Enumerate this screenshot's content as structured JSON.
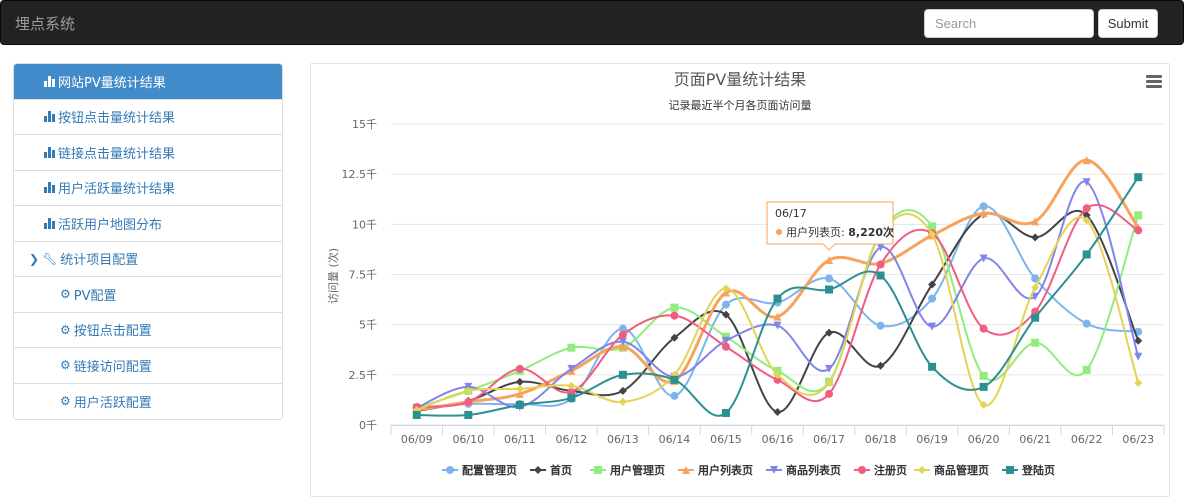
{
  "navbar": {
    "brand": "埋点系统",
    "search_placeholder": "Search",
    "submit_label": "Submit"
  },
  "sidebar": {
    "items": [
      {
        "label": "网站PV量统计结果",
        "icon": "bar-chart-icon",
        "active": true
      },
      {
        "label": "按钮点击量统计结果",
        "icon": "bar-chart-icon"
      },
      {
        "label": "链接点击量统计结果",
        "icon": "bar-chart-icon"
      },
      {
        "label": "用户活跃量统计结果",
        "icon": "bar-chart-icon"
      },
      {
        "label": "活跃用户地图分布",
        "icon": "bar-chart-icon"
      },
      {
        "label": "统计项目配置",
        "icon": "wrench-icon",
        "expanded": true
      },
      {
        "label": "PV配置",
        "icon": "gear-icon"
      },
      {
        "label": "按钮点击配置",
        "icon": "gear-icon"
      },
      {
        "label": "链接访问配置",
        "icon": "gear-icon"
      },
      {
        "label": "用户活跃配置",
        "icon": "gear-icon"
      }
    ]
  },
  "tooltip": {
    "date": "06/17",
    "series": "用户列表页",
    "value": "8,220次",
    "color": "#f7a35c"
  },
  "chart_data": {
    "type": "line",
    "title": "页面PV量统计结果",
    "subtitle": "记录最近半个月各页面访问量",
    "xlabel": "",
    "ylabel": "访问量 (次)",
    "ylim": [
      0,
      15000
    ],
    "yticks": [
      0,
      2500,
      5000,
      7500,
      10000,
      12500,
      15000
    ],
    "ytick_labels": [
      "0千",
      "2.5千",
      "5千",
      "7.5千",
      "10千",
      "12.5千",
      "15千"
    ],
    "grid": true,
    "legend": "bottom",
    "categories": [
      "06/09",
      "06/10",
      "06/11",
      "06/12",
      "06/13",
      "06/14",
      "06/15",
      "06/16",
      "06/17",
      "06/18",
      "06/19",
      "06/20",
      "06/21",
      "06/22",
      "06/23"
    ],
    "series": [
      {
        "name": "配置管理页",
        "color": "#7cb5ec",
        "marker": "circle",
        "values": [
          850,
          1050,
          1050,
          1300,
          4800,
          1450,
          6000,
          6100,
          7300,
          4950,
          6300,
          10900,
          7300,
          5050,
          4650
        ]
      },
      {
        "name": "首页",
        "color": "#434348",
        "marker": "diamond",
        "values": [
          700,
          1200,
          2150,
          1700,
          1700,
          4350,
          5500,
          650,
          4600,
          2950,
          7000,
          10500,
          9350,
          10450,
          4200
        ]
      },
      {
        "name": "用户管理页",
        "color": "#90ed7d",
        "marker": "square",
        "values": [
          850,
          1700,
          2700,
          3850,
          3850,
          5850,
          4400,
          2700,
          2150,
          9600,
          9900,
          2450,
          4100,
          2750,
          10450
        ]
      },
      {
        "name": "用户列表页",
        "color": "#f7a35c",
        "marker": "triangle",
        "values": [
          750,
          1150,
          1550,
          2700,
          3900,
          2200,
          6600,
          5400,
          8220,
          8050,
          9450,
          10550,
          10150,
          13200,
          9850
        ]
      },
      {
        "name": "商品列表页",
        "color": "#8085e9",
        "marker": "triangle-down",
        "values": [
          850,
          1900,
          900,
          2800,
          4150,
          2400,
          4200,
          4950,
          2800,
          8850,
          4900,
          8300,
          6400,
          12100,
          3400
        ]
      },
      {
        "name": "注册页",
        "color": "#f15c80",
        "marker": "circle",
        "values": [
          900,
          1150,
          2800,
          1650,
          4500,
          5450,
          3900,
          2250,
          1550,
          8000,
          9550,
          4800,
          5650,
          10800,
          9700
        ]
      },
      {
        "name": "商品管理页",
        "color": "#e4d354",
        "marker": "diamond",
        "values": [
          750,
          1700,
          1800,
          1950,
          1150,
          2500,
          6800,
          2500,
          2100,
          9500,
          9500,
          1000,
          6850,
          10200,
          2100
        ]
      },
      {
        "name": "登陆页",
        "color": "#2b908f",
        "marker": "square",
        "values": [
          500,
          500,
          1000,
          1350,
          2500,
          2250,
          600,
          6300,
          6750,
          7450,
          2900,
          1900,
          5350,
          8500,
          12350
        ]
      }
    ]
  }
}
